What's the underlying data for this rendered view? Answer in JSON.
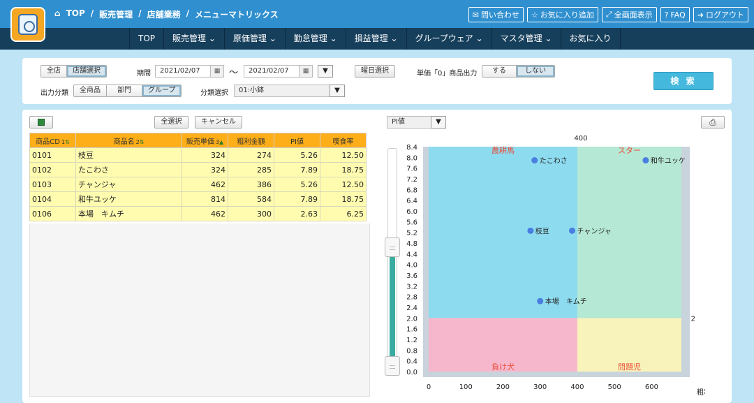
{
  "breadcrumb": [
    "TOP",
    "販売管理",
    "店舗業務",
    "メニューマトリックス"
  ],
  "header_links": [
    {
      "icon": "envelope-icon",
      "glyph": "✉",
      "label": "問い合わせ"
    },
    {
      "icon": "star-icon",
      "glyph": "☆",
      "label": "お気に入り追加"
    },
    {
      "icon": "expand-icon",
      "glyph": "⤢",
      "label": "全画面表示"
    },
    {
      "icon": "question-icon",
      "glyph": "?",
      "label": "FAQ"
    },
    {
      "icon": "logout-icon",
      "glyph": "➜",
      "label": "ログアウト"
    }
  ],
  "nav": [
    "TOP",
    "販売管理 ⌄",
    "原価管理 ⌄",
    "勤怠管理 ⌄",
    "損益管理 ⌄",
    "グループウェア ⌄",
    "マスタ管理 ⌄",
    "お気に入り"
  ],
  "filters": {
    "store_options": [
      "全店",
      "店舗選択"
    ],
    "period_label": "期間",
    "date_from": "2021/02/07",
    "tilde": "〜",
    "date_to": "2021/02/07",
    "weekday_button": "曜日選択",
    "zero_price_label": "単価「0」商品出力",
    "zero_price_options": [
      "する",
      "しない"
    ],
    "output_label": "出力分類",
    "output_options": [
      "全商品",
      "部門",
      "グループ"
    ],
    "category_label": "分類選択",
    "category_value": "01:小鉢",
    "search_button": "検 索"
  },
  "grid_toolbar": {
    "select_all": "全選択",
    "cancel": "キャンセル",
    "excel_icon": "excel-icon"
  },
  "table": {
    "columns": [
      "商品CD",
      "商品名",
      "販売単価",
      "粗利金額",
      "PI値",
      "喫食率"
    ],
    "sort_marks": [
      "1",
      "2",
      "3",
      "",
      "",
      ""
    ],
    "rows": [
      [
        "0101",
        "枝豆",
        "324",
        "274",
        "5.26",
        "12.50"
      ],
      [
        "0102",
        "たこわさ",
        "324",
        "285",
        "7.89",
        "18.75"
      ],
      [
        "0103",
        "チャンジャ",
        "462",
        "386",
        "5.26",
        "12.50"
      ],
      [
        "0104",
        "和牛ユッケ",
        "814",
        "584",
        "7.89",
        "18.75"
      ],
      [
        "0106",
        "本場　キムチ",
        "462",
        "300",
        "2.63",
        "6.25"
      ]
    ]
  },
  "chart_select": "PI値",
  "slider": {
    "low": 0.0,
    "high": 4.8
  },
  "chart_data": {
    "type": "scatter",
    "xlabel": "粗利金額",
    "xlim": [
      0,
      680
    ],
    "ylim": [
      0,
      8.4
    ],
    "xticks": [
      0,
      100,
      200,
      300,
      400,
      500,
      600
    ],
    "yticks": [
      8.4,
      8.0,
      7.6,
      7.2,
      6.8,
      6.4,
      6.0,
      5.6,
      5.2,
      4.8,
      4.4,
      4.0,
      3.6,
      3.2,
      2.8,
      2.4,
      2.0,
      1.6,
      1.2,
      0.8,
      0.4,
      0.0
    ],
    "threshold_x": 400,
    "threshold_y": 2,
    "threshold_x_label": "400",
    "threshold_y_label": "2",
    "quadrants": [
      {
        "label": "農耕馬",
        "color": "#8ddbef"
      },
      {
        "label": "スター",
        "color": "#b5e8d5"
      },
      {
        "label": "負け犬",
        "color": "#f6b6cc"
      },
      {
        "label": "問題児",
        "color": "#f7f3bb"
      }
    ],
    "points": [
      {
        "label": "枝豆",
        "x": 274,
        "y": 5.26
      },
      {
        "label": "たこわさ",
        "x": 285,
        "y": 7.89
      },
      {
        "label": "チャンジャ",
        "x": 386,
        "y": 5.26
      },
      {
        "label": "和牛ユッケ",
        "x": 584,
        "y": 7.89
      },
      {
        "label": "本場　キムチ",
        "x": 300,
        "y": 2.63
      }
    ],
    "point_color": "#4a7ee0"
  }
}
